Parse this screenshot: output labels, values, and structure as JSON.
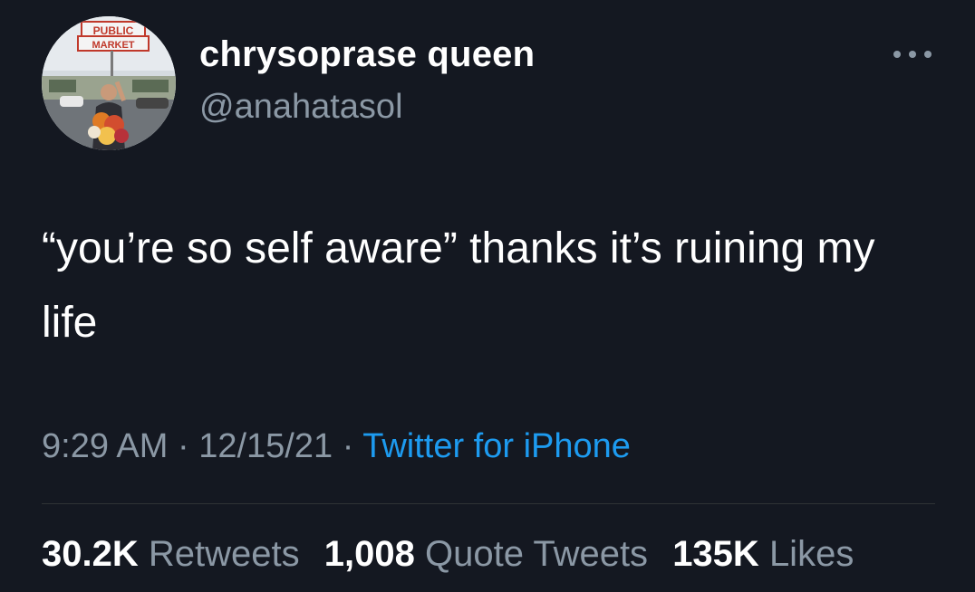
{
  "tweet": {
    "author": {
      "display_name": "chrysoprase queen",
      "handle": "@anahatasol",
      "avatar_sign_text": "PUBLIC MARKET"
    },
    "more_icon": "more-horizontal-icon",
    "text": "“you’re so self aware” thanks it’s ruining my life",
    "time": "9:29 AM",
    "date": "12/15/21",
    "separator": "·",
    "source": "Twitter for iPhone",
    "stats": {
      "retweets_count": "30.2K",
      "retweets_label": "Retweets",
      "quotes_count": "1,008",
      "quotes_label": "Quote Tweets",
      "likes_count": "135K",
      "likes_label": "Likes"
    }
  },
  "colors": {
    "background": "#141821",
    "primary_text": "#ffffff",
    "secondary_text": "#8b98a5",
    "link": "#1d9bf0",
    "divider": "#2f3336"
  }
}
